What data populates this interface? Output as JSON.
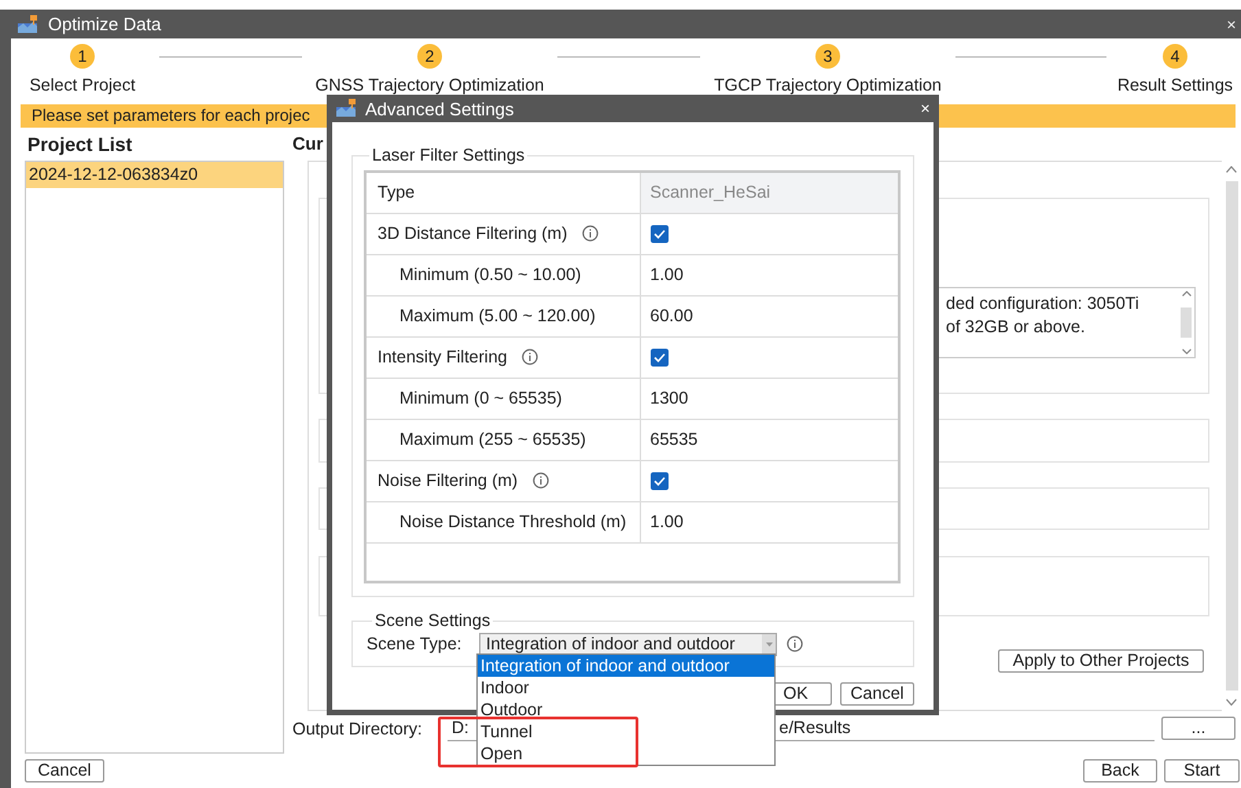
{
  "window": {
    "title": "Optimize Data",
    "close": "×"
  },
  "steps": [
    {
      "number": "1",
      "label": "Select Project"
    },
    {
      "number": "2",
      "label": "GNSS Trajectory Optimization"
    },
    {
      "number": "3",
      "label": "TGCP Trajectory Optimization"
    },
    {
      "number": "4",
      "label": "Result Settings"
    }
  ],
  "banner": "Please set parameters for each projec",
  "project_list": {
    "title": "Project List",
    "items": [
      {
        "label": "2024-12-12-063834z0",
        "selected": true
      }
    ]
  },
  "current_heading": "Cur",
  "notice_lines": [
    "ded configuration: 3050Ti",
    "of 32GB or above."
  ],
  "apply_button": "Apply to Other Projects",
  "output": {
    "label": "Output Directory:",
    "value_start": "D:",
    "value_end": "e/Results",
    "browse": "..."
  },
  "footer": {
    "cancel": "Cancel",
    "back": "Back",
    "start": "Start"
  },
  "dialog": {
    "title": "Advanced Settings",
    "close": "×",
    "laser_group": "Laser Filter Settings",
    "columns": [
      "Type",
      "Scanner_HeSai"
    ],
    "rows": [
      {
        "kind": "toggle",
        "label": "3D Distance Filtering (m)",
        "info": true,
        "checked": true
      },
      {
        "kind": "value",
        "label": "Minimum (0.50 ~ 10.00)",
        "value": "1.00"
      },
      {
        "kind": "value",
        "label": "Maximum (5.00 ~ 120.00)",
        "value": "60.00"
      },
      {
        "kind": "toggle",
        "label": "Intensity Filtering",
        "info": true,
        "checked": true
      },
      {
        "kind": "value",
        "label": "Minimum (0 ~ 65535)",
        "value": "1300"
      },
      {
        "kind": "value",
        "label": "Maximum (255 ~ 65535)",
        "value": "65535"
      },
      {
        "kind": "toggle",
        "label": "Noise Filtering (m)",
        "info": true,
        "checked": true
      },
      {
        "kind": "value",
        "label": "Noise Distance Threshold (m)",
        "value": "1.00"
      }
    ],
    "scene": {
      "group": "Scene Settings",
      "label": "Scene Type:",
      "value": "Integration of indoor and outdoor",
      "info": true,
      "options": [
        {
          "label": "Integration of indoor and outdoor",
          "selected": true
        },
        {
          "label": "Indoor",
          "selected": false
        },
        {
          "label": "Outdoor",
          "selected": false
        },
        {
          "label": "Tunnel",
          "selected": false
        },
        {
          "label": "Open",
          "selected": false
        }
      ]
    },
    "buttons": [
      "OK",
      "Cancel"
    ]
  },
  "annotations": [
    {
      "kind": "highlight-frame"
    }
  ]
}
